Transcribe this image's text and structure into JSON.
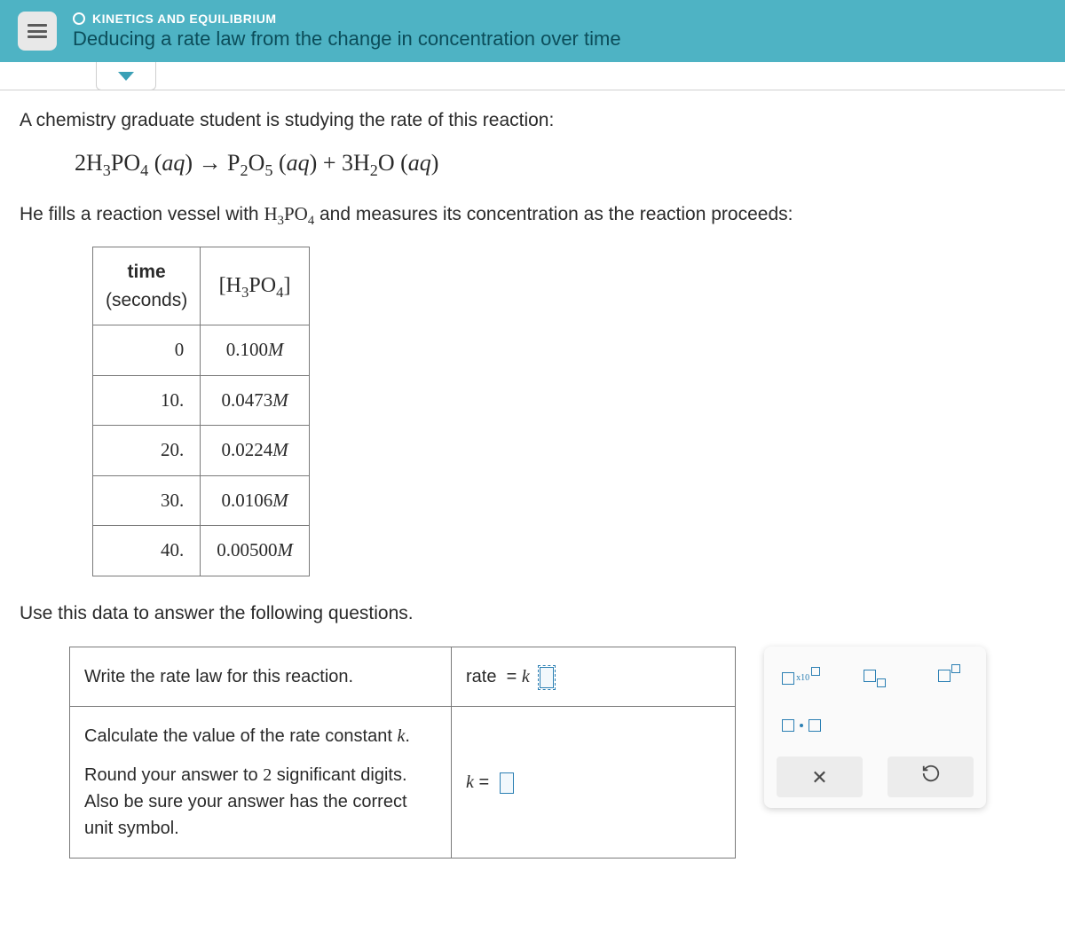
{
  "header": {
    "category": "KINETICS AND EQUILIBRIUM",
    "title": "Deducing a rate law from the change in concentration over time"
  },
  "prompt": {
    "line1": "A chemistry graduate student is studying the rate of this reaction:",
    "line2_pre": "He fills a reaction vessel with ",
    "line2_chem": "H₃PO₄",
    "line2_post": " and measures its concentration as the reaction proceeds:",
    "use_data": "Use this data to answer the following questions."
  },
  "equation": {
    "text": "2H₃PO₄ (aq) → P₂O₅ (aq) + 3H₂O (aq)"
  },
  "table": {
    "head_time_1": "time",
    "head_time_2": "(seconds)",
    "head_conc": "[H₃PO₄]",
    "rows": [
      {
        "t": "0",
        "c": "0.100 M"
      },
      {
        "t": "10.",
        "c": "0.0473 M"
      },
      {
        "t": "20.",
        "c": "0.0224 M"
      },
      {
        "t": "30.",
        "c": "0.0106 M"
      },
      {
        "t": "40.",
        "c": "0.00500 M"
      }
    ]
  },
  "questions": {
    "q1": "Write the rate law for this reaction.",
    "a1_prefix": "rate  = k ",
    "q2_l1": "Calculate the value of the rate constant k.",
    "q2_l2": "Round your answer to 2 significant digits. Also be sure your answer has the correct unit symbol.",
    "a2_prefix": "k = "
  },
  "toolbox": {
    "sci": "x10",
    "clear": "×",
    "reset": "↺"
  }
}
